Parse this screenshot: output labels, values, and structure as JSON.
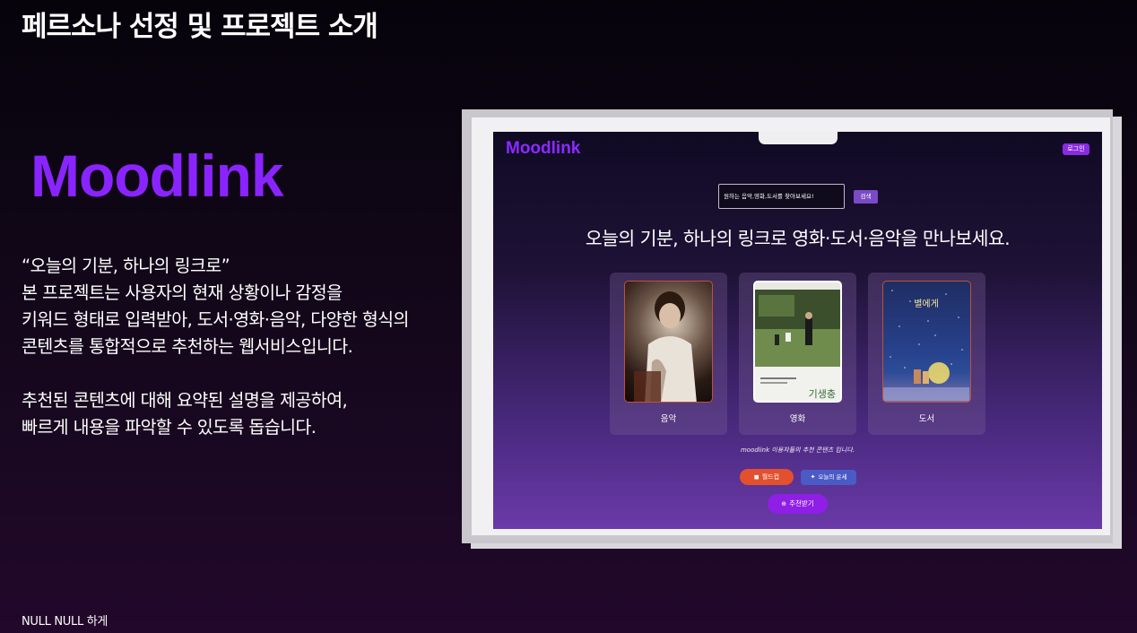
{
  "slide": {
    "title": "페르소나 선정 및 프로젝트 소개",
    "brand": "Moodlink",
    "description_lines": [
      "“오늘의 기분, 하나의 링크로”",
      "본 프로젝트는 사용자의 현재 상황이나 감정을",
      "키워드 형태로 입력받아, 도서·영화·음악, 다양한 형식의",
      "콘텐츠를 통합적으로 추천하는 웹서비스입니다.",
      "추천된 콘텐츠에 대해 요약된 설명을 제공하여,",
      "빠르게 내용을 파악할 수 있도록 돕습니다."
    ],
    "footer": "NULL NULL 하게"
  },
  "app": {
    "logo": "Moodlink",
    "login_label": "로그인",
    "search": {
      "placeholder": "원하는 음악,영화,도서를 찾아보세요!",
      "button_label": "검색"
    },
    "headline": "오늘의 기분, 하나의 링크로 영화·도서·음악을 만나보세요.",
    "cards": [
      {
        "label": "음악",
        "image": "music-album-cover"
      },
      {
        "label": "영화",
        "image": "movie-poster",
        "poster_title": "기생충"
      },
      {
        "label": "도서",
        "image": "book-cover",
        "poster_title": "별에게"
      }
    ],
    "subtitle": "moodlink 이용자들의 추천 콘텐츠 입니다.",
    "buttons": {
      "worldcup": "월드컵",
      "fortune": "오늘의 운세",
      "recommend": "추천받기"
    },
    "icons": {
      "worldcup": "gamepad-icon",
      "fortune": "sparkle-icon",
      "recommend": "plus-circle-icon"
    }
  },
  "colors": {
    "brand": "#8a24ff",
    "background": "#120719",
    "accent_orange": "#e2502e",
    "accent_blue": "#4a5bc6",
    "accent_purple": "#8f1ee6"
  }
}
